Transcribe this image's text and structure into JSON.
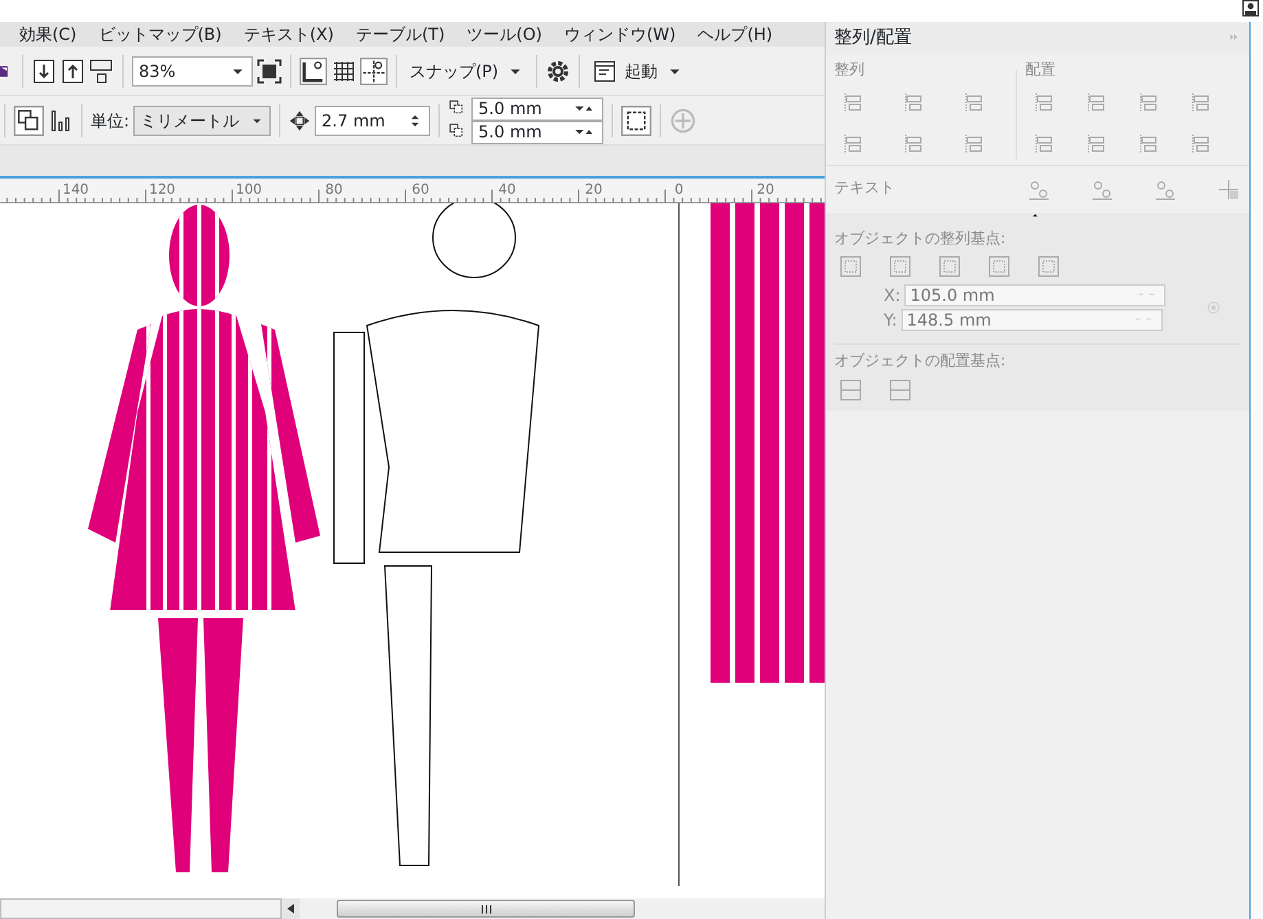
{
  "menu": [
    "効果(C)",
    "ビットマップ(B)",
    "テキスト(X)",
    "テーブル(T)",
    "ツール(O)",
    "ウィンドウ(W)",
    "ヘルプ(H)"
  ],
  "toolbar": {
    "zoom": "83%",
    "snap": "スナップ(P)",
    "launch": "起動"
  },
  "property_bar": {
    "unit_label": "単位:",
    "unit_value": "ミリメートル",
    "nudge": "2.7 mm",
    "duplicate_x": "5.0 mm",
    "duplicate_y": "5.0 mm"
  },
  "ruler": [
    "140",
    "120",
    "100",
    "80",
    "60",
    "40",
    "20",
    "0",
    "20"
  ],
  "docker": {
    "title": "整列/配置",
    "disabled": true,
    "align_heading": "整列",
    "distribute_heading": "配置",
    "text_label": "テキスト",
    "align_anchor_label": "オブジェクトの整列基点:",
    "x_label": "X:",
    "x_value": "105.0 mm",
    "y_label": "Y:",
    "y_value": "148.5 mm",
    "distribute_anchor_label": "オブジェクトの配置基点:"
  }
}
